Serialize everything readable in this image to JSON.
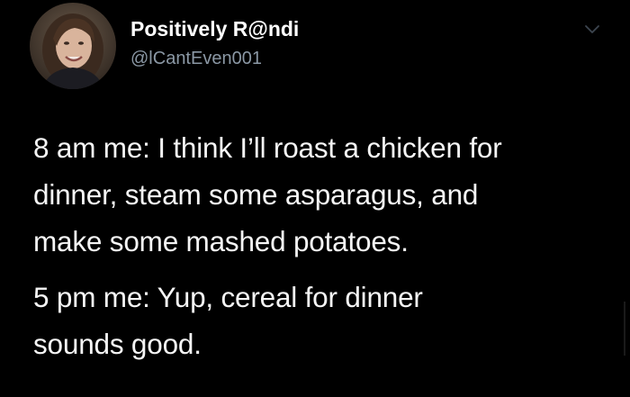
{
  "tweet": {
    "author": {
      "display_name": "Positively R@ndi",
      "handle": "@lCantEven001",
      "avatar_icon": "profile-photo"
    },
    "menu_icon": "chevron-down-icon",
    "paragraphs": [
      "8 am me: I think I’ll roast a chicken for\ndinner, steam some asparagus, and\nmake some mashed potatoes.",
      "5 pm me: Yup, cereal for dinner\nsounds good."
    ],
    "colors": {
      "background": "#000000",
      "name": "#ffffff",
      "handle": "#8b98a5",
      "text": "#f5f5f5"
    }
  }
}
